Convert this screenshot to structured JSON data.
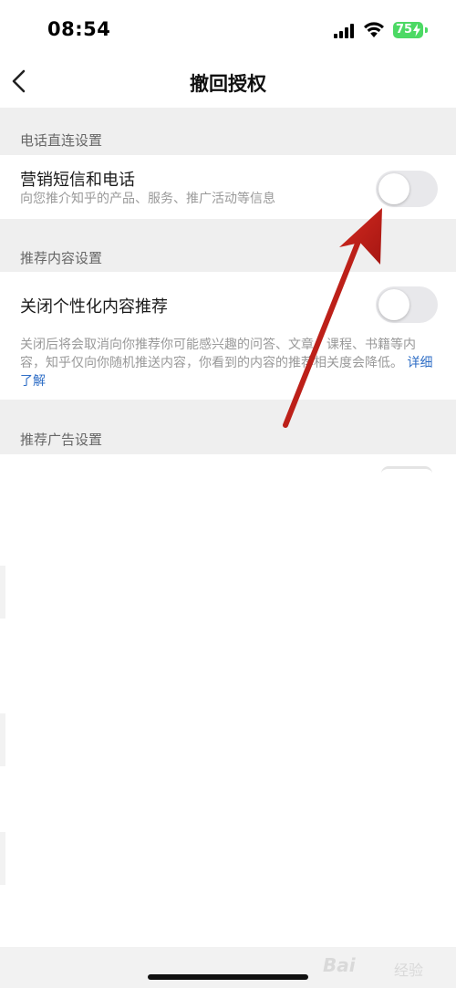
{
  "status_bar": {
    "time": "08:54",
    "battery": "75"
  },
  "nav": {
    "title": "撤回授权",
    "back_icon": "chevron-left-icon"
  },
  "sections": [
    {
      "header": "电话直连设置",
      "rows": [
        {
          "title": "营销短信和电话",
          "description": "向您推介知乎的产品、服务、推广活动等信息",
          "toggle_on": false
        }
      ]
    },
    {
      "header": "推荐内容设置",
      "rows": [
        {
          "title": "关闭个性化内容推荐",
          "description": "关闭后将会取消向你推荐你可能感兴趣的问答、文章、课程、书籍等内容，知乎仅向你随机推送内容，你看到的内容的推荐相关度会降低。",
          "link": "详细了解",
          "toggle_on": false
        }
      ]
    },
    {
      "header": "推荐广告设置",
      "rows": []
    }
  ],
  "watermark": {
    "text": "Bai",
    "text2": "经验"
  },
  "colors": {
    "section_bg": "#efefef",
    "toggle_off": "#e8e8eb",
    "link": "#2f6ec6",
    "annotation_arrow": "#c8221c",
    "battery": "#4cd964"
  }
}
